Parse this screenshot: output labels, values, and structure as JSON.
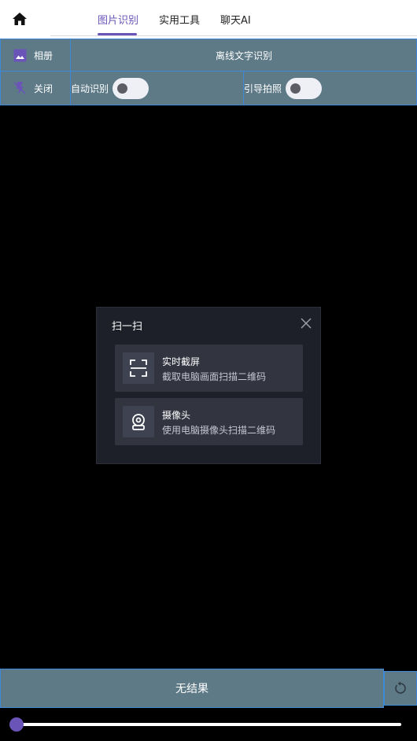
{
  "header": {
    "tabs": [
      {
        "label": "图片识别",
        "active": true
      },
      {
        "label": "实用工具",
        "active": false
      },
      {
        "label": "聊天AI",
        "active": false
      }
    ]
  },
  "toolbar": {
    "album_label": "相册",
    "mode_label": "离线文字识别",
    "close_label": "关闭",
    "auto_recognize_label": "自动识别",
    "auto_recognize_on": false,
    "guide_photo_label": "引导拍照",
    "guide_photo_on": false
  },
  "scan_dialog": {
    "title": "扫一扫",
    "options": [
      {
        "title": "实时截屏",
        "description": "截取电脑画面扫描二维码",
        "icon": "scan-frame-icon"
      },
      {
        "title": "摄像头",
        "description": "使用电脑摄像头扫描二维码",
        "icon": "webcam-icon"
      }
    ]
  },
  "footer": {
    "result_text": "无结果",
    "slider_value": 0
  },
  "colors": {
    "accent": "#6a54b8",
    "toolbar": "#5e7a87",
    "border": "#3f88d8",
    "dialog_bg": "#1d2029"
  }
}
